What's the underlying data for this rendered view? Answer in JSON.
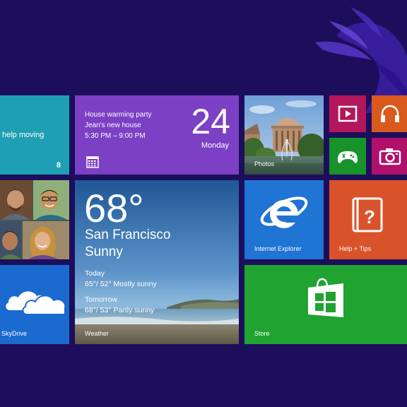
{
  "tiles": {
    "mail": {
      "subject": "help moving",
      "count": "8"
    },
    "calendar": {
      "event_title": "House warming party",
      "event_location": "Jean's new house",
      "event_time": "5:30 PM – 9:00 PM",
      "day_number": "24",
      "day_name": "Monday"
    },
    "photos": {
      "label": "Photos"
    },
    "video": {
      "icon": "video-play-icon"
    },
    "music": {
      "icon": "headphones-icon"
    },
    "games": {
      "icon": "xbox-controller-icon"
    },
    "camera": {
      "icon": "camera-icon"
    },
    "people": {
      "icon": "people-photos"
    },
    "weather": {
      "temperature": "68°",
      "city": "San Francisco",
      "condition": "Sunny",
      "today_label": "Today",
      "today_forecast": "65°/ 52° Mostly sunny",
      "tomorrow_label": "Tomorrow",
      "tomorrow_forecast": "68°/ 53° Partly sunny",
      "label": "Weather"
    },
    "internet_explorer": {
      "label": "Internet Explorer"
    },
    "help_tips": {
      "label": "Help + Tips"
    },
    "skydrive": {
      "label": "SkyDrive"
    },
    "store": {
      "label": "Store"
    }
  },
  "colors": {
    "background": "#1d0e5c",
    "mail": "#1f9fb3",
    "calendar": "#7b40c3",
    "video": "#b3165a",
    "music": "#d95a1c",
    "games": "#16932b",
    "camera": "#b0106a",
    "internet_explorer": "#1f74d4",
    "help_tips": "#d9532a",
    "skydrive": "#1a6ad0",
    "store": "#20a330"
  }
}
